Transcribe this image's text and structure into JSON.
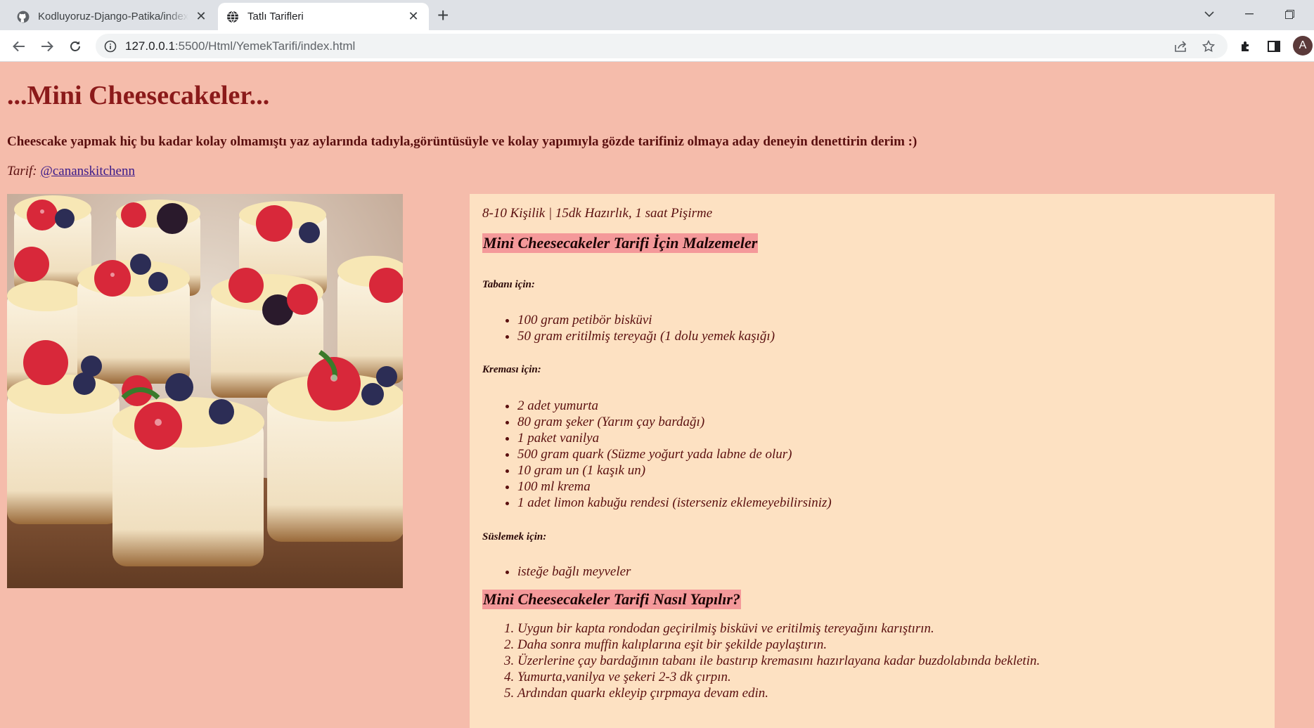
{
  "browser": {
    "tabs": [
      {
        "title": "Kodluyoruz-Django-Patika/index.html",
        "active": false
      },
      {
        "title": "Tatlı Tarifleri",
        "active": true
      }
    ],
    "new_tab_label": "+",
    "url_host": "127.0.0.1",
    "url_path": ":5500/Html/YemekTarifi/index.html",
    "profile_initial": "A"
  },
  "page": {
    "title": "...Mini Cheesecakeler...",
    "intro": "Cheescake yapmak hiç bu kadar kolay olmamıştı yaz aylarında tadıyla,görüntüsüyle ve kolay yapımıyla gözde tarifiniz olmaya aday deneyin denettirin derim :)",
    "credit_label": "Tarif:",
    "credit_link": "@cananskitchenn",
    "meta": "8-10 Kişilik | 15dk Hazırlık, 1 saat Pişirme",
    "ingredients_heading": "Mini Cheesecakeler Tarifi İçin Malzemeler",
    "base_heading": "Tabanı için:",
    "base_items": [
      "100 gram petibör bisküvi",
      "50 gram eritilmiş tereyağı (1 dolu yemek kaşığı)"
    ],
    "cream_heading": "Kreması için:",
    "cream_items": [
      "2 adet yumurta",
      "80 gram şeker (Yarım çay bardağı)",
      "1 paket vanilya",
      "500 gram quark (Süzme yoğurt yada labne de olur)",
      "10 gram un (1 kaşık un)",
      "100 ml krema",
      "1 adet limon kabuğu rendesi (isterseniz eklemeyebilirsiniz)"
    ],
    "decor_heading": "Süslemek için:",
    "decor_items": [
      "isteğe bağlı meyveler"
    ],
    "steps_heading": "Mini Cheesecakeler Tarifi Nasıl Yapılır?",
    "steps": [
      "Uygun bir kapta rondodan geçirilmiş bisküvi ve eritilmiş tereyağını karıştırın.",
      "Daha sonra muffin kalıplarına eşit bir şekilde paylaştırın.",
      "Üzerlerine çay bardağının tabanı ile bastırıp kremasını hazırlayana kadar buzdolabında bekletin.",
      "Yumurta,vanilya ve şekeri 2-3 dk çırpın.",
      "Ardından quarkı ekleyip çırpmaya devam edin."
    ]
  },
  "colors": {
    "page_bg": "#f5bcab",
    "card_bg": "#fde1c2",
    "heading_highlight": "#f4999a",
    "title_color": "#8b1a1a"
  },
  "icons": [
    "github-icon",
    "globe-icon",
    "close-icon",
    "back-icon",
    "forward-icon",
    "reload-icon",
    "info-icon",
    "share-icon",
    "star-icon",
    "extensions-icon",
    "side-panel-icon",
    "chevron-down-icon",
    "minimize-icon",
    "maximize-icon"
  ]
}
